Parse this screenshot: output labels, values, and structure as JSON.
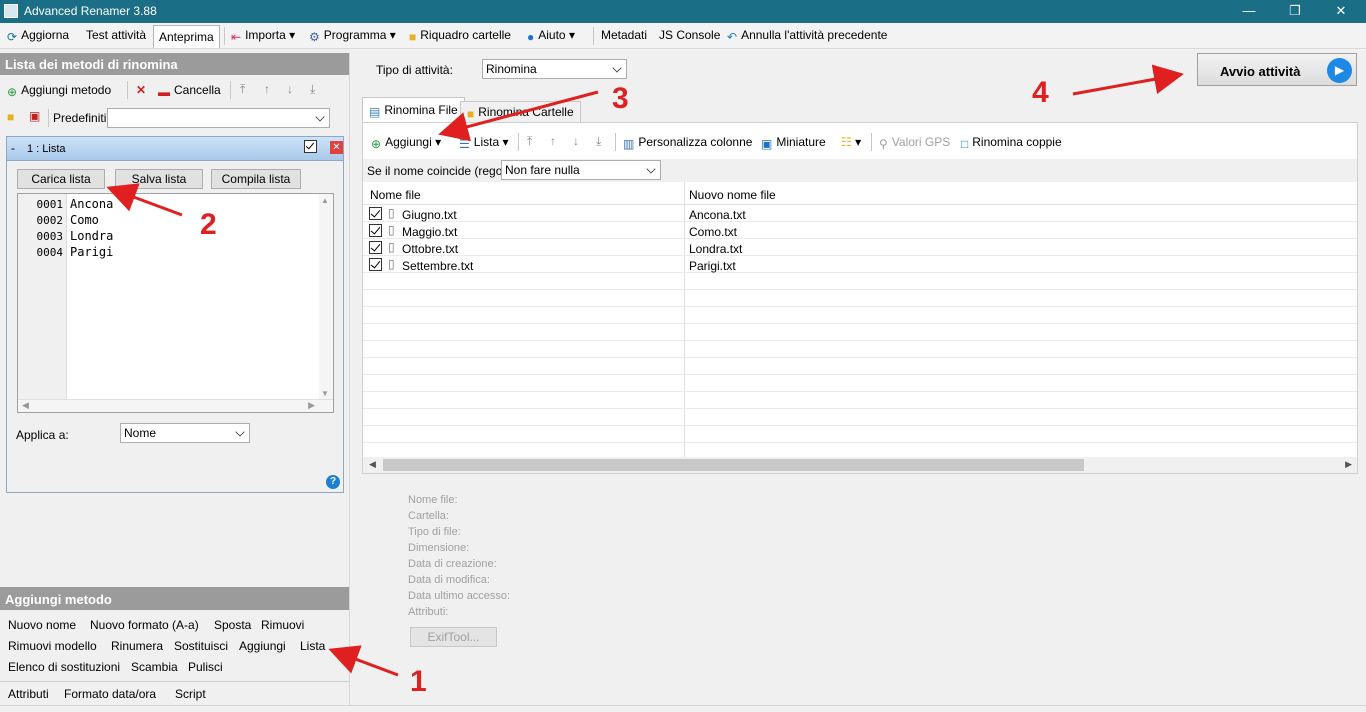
{
  "window": {
    "title": "Advanced Renamer 3.88"
  },
  "menu": {
    "refresh": "Aggiorna",
    "test": "Test attività",
    "preview": "Anteprima",
    "import": "Importa",
    "program": "Programma",
    "folder_panel": "Riquadro cartelle",
    "help": "Aiuto",
    "metadata": "Metadati",
    "js_console": "JS Console",
    "undo": "Annulla l'attività precedente"
  },
  "methods_panel": {
    "title": "Lista dei metodi di rinomina",
    "add_method": "Aggiungi metodo",
    "delete": "Cancella",
    "presets_label": "Predefiniti:",
    "presets_value": ""
  },
  "list_method": {
    "header": "1 : Lista",
    "load_button": "Carica lista",
    "save_button": "Salva lista",
    "fill_button": "Compila lista",
    "lines": [
      {
        "num": "0001",
        "text": "Ancona"
      },
      {
        "num": "0002",
        "text": "Como"
      },
      {
        "num": "0003",
        "text": "Londra"
      },
      {
        "num": "0004",
        "text": "Parigi"
      }
    ],
    "apply_label": "Applica a:",
    "apply_value": "Nome"
  },
  "add_method_panel": {
    "title": "Aggiungi metodo",
    "row1": [
      "Nuovo nome",
      "Nuovo formato (A-a)",
      "Sposta",
      "Rimuovi"
    ],
    "row2": [
      "Rimuovi modello",
      "Rinumera",
      "Sostituisci",
      "Aggiungi",
      "Lista"
    ],
    "row3": [
      "Elenco di sostituzioni",
      "Scambia",
      "Pulisci"
    ],
    "row4": [
      "Attributi",
      "Formato data/ora",
      "Script"
    ]
  },
  "batch": {
    "mode_label": "Tipo di attività:",
    "mode_value": "Rinomina",
    "start_button": "Avvio attività"
  },
  "tabs": {
    "files": "Rinomina File",
    "folders": "Rinomina Cartelle"
  },
  "file_toolbar": {
    "add": "Aggiungi",
    "list": "Lista",
    "columns": "Personalizza colonne",
    "thumbnails": "Miniature",
    "gps": "Valori GPS",
    "pair_rename": "Rinomina coppie"
  },
  "collision": {
    "label": "Se il nome coincide (regola):",
    "value": "Non fare nulla"
  },
  "grid": {
    "col_name": "Nome file",
    "col_new": "Nuovo nome file",
    "rows": [
      {
        "name": "Giugno.txt",
        "new": "Ancona.txt"
      },
      {
        "name": "Maggio.txt",
        "new": "Como.txt"
      },
      {
        "name": "Ottobre.txt",
        "new": "Londra.txt"
      },
      {
        "name": "Settembre.txt",
        "new": "Parigi.txt"
      }
    ]
  },
  "file_info": {
    "name": "Nome file:",
    "folder": "Cartella:",
    "type": "Tipo di file:",
    "size": "Dimensione:",
    "created": "Data di creazione:",
    "modified": "Data di modifica:",
    "accessed": "Data ultimo accesso:",
    "attributes": "Attributi:",
    "exiftool": "ExifTool..."
  },
  "annotations": {
    "a1": "1",
    "a2": "2",
    "a3": "3",
    "a4": "4"
  },
  "colors": {
    "titlebar": "#1a6e86",
    "arrow": "#e02020",
    "play": "#1e88e5"
  }
}
